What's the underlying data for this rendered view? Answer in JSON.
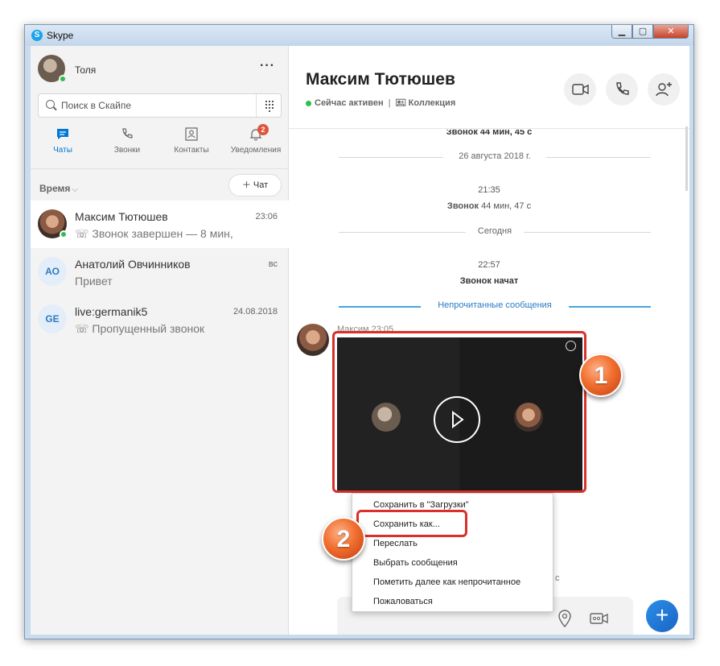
{
  "window": {
    "title": "Skype",
    "icon": "skype-logo-icon"
  },
  "profile": {
    "name": "Толя",
    "status_color": "#2fbf4d",
    "more_label": "···"
  },
  "search": {
    "placeholder": "Поиск в Скайпе"
  },
  "nav_tabs": [
    {
      "label": "Чаты",
      "icon": "chat-icon",
      "active": true
    },
    {
      "label": "Звонки",
      "icon": "phone-icon"
    },
    {
      "label": "Контакты",
      "icon": "contacts-icon"
    },
    {
      "label": "Уведомления",
      "icon": "bell-icon",
      "badge": "2"
    }
  ],
  "sort": {
    "label": "Время",
    "chevron": "⌵"
  },
  "new_chat": {
    "label": "＋ Чат"
  },
  "chats": [
    {
      "name": "Максим Тютюшев",
      "time": "23:06",
      "preview": "☏ Звонок завершен — 8 мин,",
      "selected": true,
      "online": true
    },
    {
      "name": "Анатолий Овчинников",
      "time": "вс",
      "preview": "Привет",
      "initials": "АО"
    },
    {
      "name": "live:germanik5",
      "time": "24.08.2018",
      "preview": "☏ Пропущенный звонок",
      "initials": "GE"
    }
  ],
  "conversation": {
    "contact_name": "Максим Тютюшев",
    "status": "Сейчас активен",
    "collection": "🖭 Коллекция",
    "separator": "|",
    "header_buttons": [
      "video-call-icon",
      "phone-call-icon",
      "add-person-icon"
    ],
    "events": {
      "top_cut": "Звонок 44 мин, 45 с",
      "date1": "26 августа 2018 г.",
      "time1": "21:35",
      "call1_prefix": "Звонок",
      "call1_rest": " 44 мин, 47 с",
      "date2": "Сегодня",
      "time2": "22:57",
      "call2": "Звонок начат",
      "unread": "Непрочитанные сообщения"
    },
    "message": {
      "meta": "Максим 23:05",
      "type": "video-call-recording"
    },
    "partial_right_text": "с"
  },
  "context_menu": [
    "Сохранить в \"Загрузки\"",
    "Сохранить как...",
    "Переслать",
    "Выбрать сообщения",
    "Пометить далее как непрочитанное",
    "Пожаловаться"
  ],
  "annotations": {
    "callout1": "1",
    "callout2": "2",
    "accent": "#d9302a"
  },
  "colors": {
    "online": "#2fbf4d",
    "accent_blue": "#0078d4",
    "badge": "#e0533d"
  }
}
